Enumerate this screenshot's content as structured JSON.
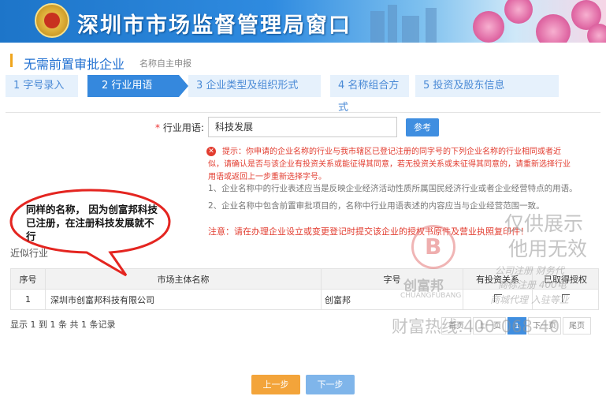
{
  "banner": {
    "title": "深圳市市场监督管理局窗口"
  },
  "header": {
    "title": "无需前置审批企业",
    "subtitle": "名称自主申报"
  },
  "steps": [
    {
      "label": "1 字号录入"
    },
    {
      "label": "2 行业用语"
    },
    {
      "label": "3 企业类型及组织形式"
    },
    {
      "label": "4 名称组合方式"
    },
    {
      "label": "5 投资及股东信息"
    }
  ],
  "form": {
    "industry_label": "行业用语:",
    "industry_value": "科技发展",
    "reference_button": "参考",
    "tip": "提示：你申请的企业名称的行业与我市辖区已登记注册的同字号的下列企业名称的行业相同或者近似，请确认是否与该企业有投资关系或能征得其同意，若无投资关系或未征得其同意的，请重新选择行业用语或返回上一步重新选择字号。",
    "note1": "1、企业名称中的行业表述应当是反映企业经济活动性质所属国民经济行业或者企业经营特点的用语。",
    "note2": "2、企业名称中包含前置审批项目的，名称中行业用语表述的内容应当与企业经营范围一致。",
    "warning": "注意：请在办理企业设立或变更登记时提交该企业的授权书原件及营业执照复印件！"
  },
  "table": {
    "section_label": "近似行业",
    "headers": [
      "序号",
      "市场主体名称",
      "字号",
      "有投资关系",
      "已取得授权"
    ],
    "rows": [
      {
        "index": "1",
        "name": "深圳市创富邦科技有限公司",
        "brand": "创富邦"
      }
    ],
    "footer": "显示 1 到 1 条 共 1 条记录"
  },
  "pager": {
    "prev": "上一页",
    "current": "1",
    "next": "下一页",
    "last": "尾页",
    "first": "首页"
  },
  "buttons": {
    "prev": "上一步",
    "next": "下一步"
  },
  "annotation": {
    "text": "同样的名称， 因为创富邦科技已注册，在注册科技发展就不行"
  },
  "watermark": {
    "line1": "仅供展示",
    "line2": "他用无效",
    "brand": "创富邦",
    "brand_en": "CHUANGFUBANG",
    "svc1": "公司注册 财务代",
    "svc2": "商标注册 400电",
    "svc3": "商城代理 入驻等业",
    "hotline": "财富热线:400-068-40"
  }
}
